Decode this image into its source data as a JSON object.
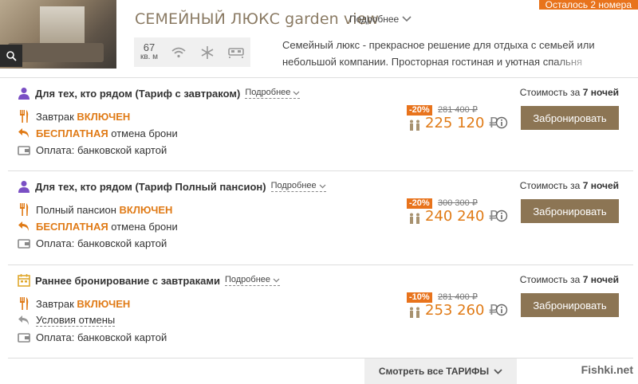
{
  "room": {
    "title": "СЕМЕЙНЫЙ ЛЮКС garden view",
    "more_label": "Подробнее",
    "badge": "Осталось 2 номера",
    "area_value": "67",
    "area_unit": "кв. м",
    "amenities": [
      "wifi-icon",
      "snowflake-icon",
      "bed-icon"
    ],
    "description": "Семейный люкс - прекрасное решение для отдыха с семьей или небольшой компании. Просторная гостиная и уютная спальня созданы с учетом всех"
  },
  "tariffs": [
    {
      "name": "Для тех, кто рядом (Тариф с завтраком)",
      "more_label": "Подробнее",
      "meal_prefix": "Завтрак ",
      "meal_status": "ВКЛЮЧЕН",
      "cancel_highlight": "БЕСПЛАТНАЯ",
      "cancel_text": " отмена брони",
      "payment": "Оплата: банковской картой",
      "discount": "-20%",
      "old_price": "281 400 ₽",
      "new_price": "225 120",
      "currency": "₽",
      "cost_prefix": "Стоимость за ",
      "cost_nights": "7 ночей",
      "book_label": "Забронировать"
    },
    {
      "name": "Для тех, кто рядом (Тариф Полный пансион)",
      "more_label": "Подробнее",
      "meal_prefix": "Полный пансион ",
      "meal_status": "ВКЛЮЧЕН",
      "cancel_highlight": "БЕСПЛАТНАЯ",
      "cancel_text": " отмена брони",
      "payment": "Оплата: банковской картой",
      "discount": "-20%",
      "old_price": "300 300 ₽",
      "new_price": "240 240",
      "currency": "₽",
      "cost_prefix": "Стоимость за ",
      "cost_nights": "7 ночей",
      "book_label": "Забронировать"
    },
    {
      "name": "Раннее бронирование с завтраками",
      "more_label": "Подробнее",
      "meal_prefix": "Завтрак ",
      "meal_status": "ВКЛЮЧЕН",
      "cancel_text": "Условия отмены",
      "payment": "Оплата: банковской картой",
      "discount": "-10%",
      "old_price": "281 400 ₽",
      "new_price": "253 260",
      "currency": "₽",
      "cost_prefix": "Стоимость за ",
      "cost_nights": "7 ночей",
      "book_label": "Забронировать"
    }
  ],
  "footer": {
    "all_tariffs_label": "Смотреть все ТАРИФЫ",
    "watermark": "Fishki.net"
  },
  "colors": {
    "accent": "#e07b17",
    "button": "#8c7554",
    "title": "#8a7a63"
  }
}
